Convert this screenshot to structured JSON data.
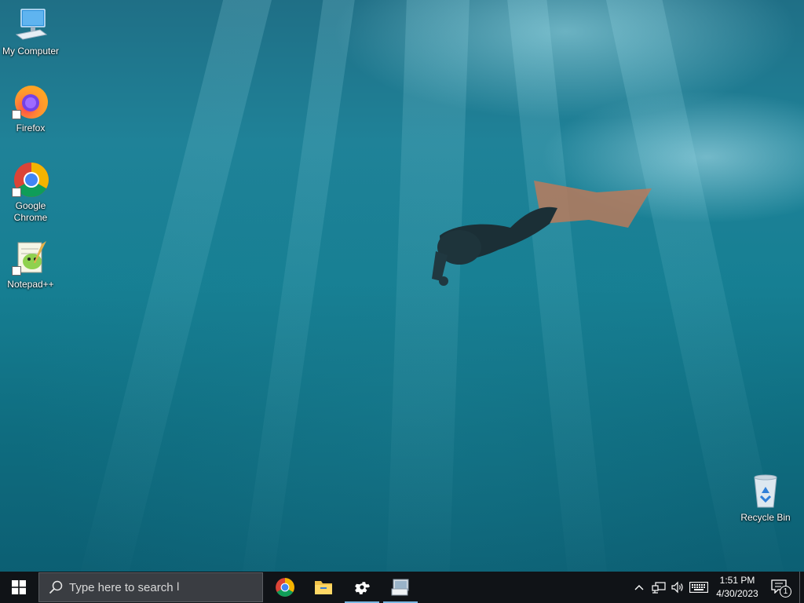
{
  "desktop": {
    "icons": [
      {
        "label": "My Computer",
        "icon": "computer-icon"
      },
      {
        "label": "Firefox",
        "icon": "firefox-icon"
      },
      {
        "label": "Google Chrome",
        "icon": "chrome-icon"
      },
      {
        "label": "Notepad++",
        "icon": "notepadpp-icon"
      },
      {
        "label": "Recycle Bin",
        "icon": "recycle-bin-icon"
      }
    ]
  },
  "taskbar": {
    "start_icon": "windows-logo-icon",
    "search": {
      "placeholder": "Type here to search",
      "icon": "search-icon"
    },
    "pinned": [
      {
        "name": "Google Chrome",
        "icon": "chrome-icon"
      },
      {
        "name": "File Explorer",
        "icon": "folder-icon"
      },
      {
        "name": "Settings",
        "icon": "gear-icon",
        "active": true
      },
      {
        "name": "Remote Desktop",
        "icon": "app-window-icon",
        "active": true
      }
    ],
    "tray": {
      "icons": [
        "chevron-up-icon",
        "network-icon",
        "volume-icon",
        "keyboard-icon"
      ],
      "time": "1:51 PM",
      "date": "4/30/2023",
      "notification_count": "1"
    }
  },
  "colors": {
    "taskbar_bg": "#101317",
    "search_bg": "#3a3d42",
    "accent": "#7ab7e3",
    "water": "#167f93"
  }
}
